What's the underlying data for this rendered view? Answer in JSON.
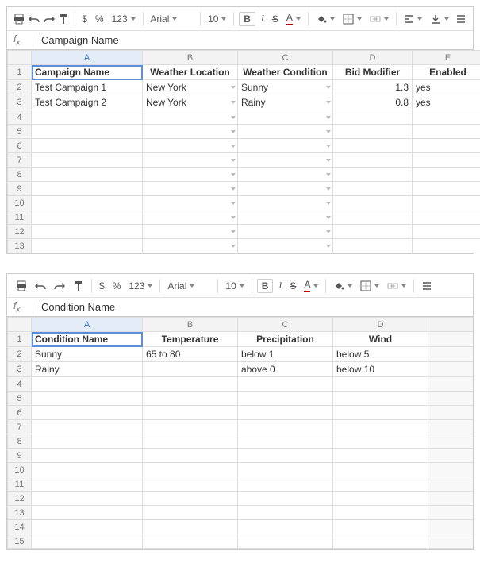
{
  "sheet1": {
    "fx_content": "Campaign Name",
    "font_name": "Arial",
    "font_size": "10",
    "selected_cell": "A1",
    "columns": [
      "A",
      "B",
      "C",
      "D",
      "E"
    ],
    "headers": {
      "A": "Campaign Name",
      "B": "Weather Location",
      "C": "Weather Condition",
      "D": "Bid Modifier",
      "E": "Enabled"
    },
    "rows": [
      {
        "A": "Test Campaign 1",
        "B": "New York",
        "C": "Sunny",
        "D": "1.3",
        "E": "yes"
      },
      {
        "A": "Test Campaign 2",
        "B": "New York",
        "C": "Rainy",
        "D": "0.8",
        "E": "yes"
      }
    ],
    "blank_rows": 11
  },
  "sheet2": {
    "fx_content": "Condition Name",
    "font_name": "Arial",
    "font_size": "10",
    "selected_cell": "A1",
    "columns": [
      "A",
      "B",
      "C",
      "D"
    ],
    "headers": {
      "A": "Condition Name",
      "B": "Temperature",
      "C": "Precipitation",
      "D": "Wind"
    },
    "rows": [
      {
        "A": "Sunny",
        "B": "65 to 80",
        "C": "below 1",
        "D": "below 5"
      },
      {
        "A": "Rainy",
        "B": "",
        "C": "above 0",
        "D": "below 10"
      }
    ],
    "blank_rows": 12
  },
  "toolbar": {
    "currency": "$",
    "percent": "%",
    "number_format": "123",
    "bold": "B",
    "italic": "I",
    "strike": "S",
    "text_color": "A"
  },
  "chart_data": [
    {
      "type": "table",
      "title": "Campaigns",
      "columns": [
        "Campaign Name",
        "Weather Location",
        "Weather Condition",
        "Bid Modifier",
        "Enabled"
      ],
      "rows": [
        [
          "Test Campaign 1",
          "New York",
          "Sunny",
          1.3,
          "yes"
        ],
        [
          "Test Campaign 2",
          "New York",
          "Rainy",
          0.8,
          "yes"
        ]
      ]
    },
    {
      "type": "table",
      "title": "Conditions",
      "columns": [
        "Condition Name",
        "Temperature",
        "Precipitation",
        "Wind"
      ],
      "rows": [
        [
          "Sunny",
          "65 to 80",
          "below 1",
          "below 5"
        ],
        [
          "Rainy",
          "",
          "above 0",
          "below 10"
        ]
      ]
    }
  ]
}
